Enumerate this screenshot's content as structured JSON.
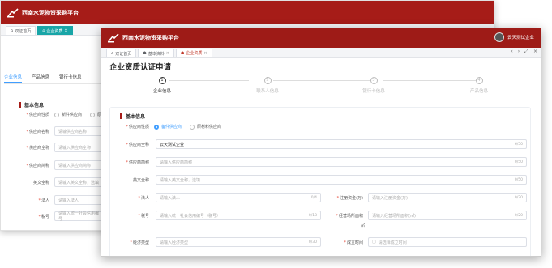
{
  "back": {
    "brand": "西南水泥物资采购平台",
    "tabs": [
      "双证首页",
      "企业资质"
    ],
    "subtabs": [
      "企业信息",
      "产品信息",
      "银行卡信息"
    ],
    "section": "基本信息",
    "fields": [
      {
        "label": "供应商性质",
        "value": "",
        "options": [
          "新件供应商",
          "原"
        ]
      },
      {
        "label": "供应商名称",
        "placeholder": "请输供应商名称"
      },
      {
        "label": "供应商全称",
        "placeholder": "请输入供应商全称"
      },
      {
        "label": "供应商简称",
        "placeholder": "请输入供应商简称"
      },
      {
        "label": "英文全称",
        "placeholder": "请输入英文全称，选填"
      },
      {
        "label": "法人",
        "placeholder": "请输入法人"
      },
      {
        "label": "税号",
        "placeholder": "请输入统一社会信用编号"
      }
    ]
  },
  "front": {
    "brand": "西南水泥物资采购平台",
    "user": "云天测试企业",
    "tabs": [
      "双证首页",
      "基本资料",
      "企业资质"
    ],
    "title": "企业资质认证申请",
    "steps": [
      {
        "num": "1",
        "label": "企业信息"
      },
      {
        "num": "2",
        "label": "联系人信息"
      },
      {
        "num": "3",
        "label": "银行卡信息"
      },
      {
        "num": "4",
        "label": "产品信息"
      }
    ],
    "section": "基本信息",
    "supplier_type_label": "供应商性质",
    "supplier_type_options": [
      "备件供应商",
      "原材料供应商"
    ],
    "full_name_label": "供应商全称",
    "full_name_value": "云天测试企业",
    "full_name_count": "6/50",
    "short_name_label": "供应商简称",
    "short_name_placeholder": "请输入供应商简称",
    "short_name_count": "0/50",
    "en_label": "英文全称",
    "en_placeholder": "请输入英文全称，选填",
    "en_count": "0/50",
    "legal_label": "法人",
    "legal_placeholder": "请输入法人",
    "legal_count": "0/4",
    "capital_label": "注册资金(万)",
    "capital_placeholder": "请输入注册资金(万)",
    "capital_count": "0/20",
    "tax_label": "税号",
    "tax_placeholder": "请输入统一社会信用编号（税号）",
    "tax_count": "0/18",
    "area_label": "经营场所面积",
    "area_placeholder": "请输入经营场所面积(㎡)",
    "area_count": "0/20",
    "area_unit": "㎡",
    "econ_label": "经济类型",
    "econ_placeholder": "请输入经济类型",
    "econ_count": "0/30",
    "found_label": "成立时间",
    "found_placeholder": "请选择成立时间"
  }
}
